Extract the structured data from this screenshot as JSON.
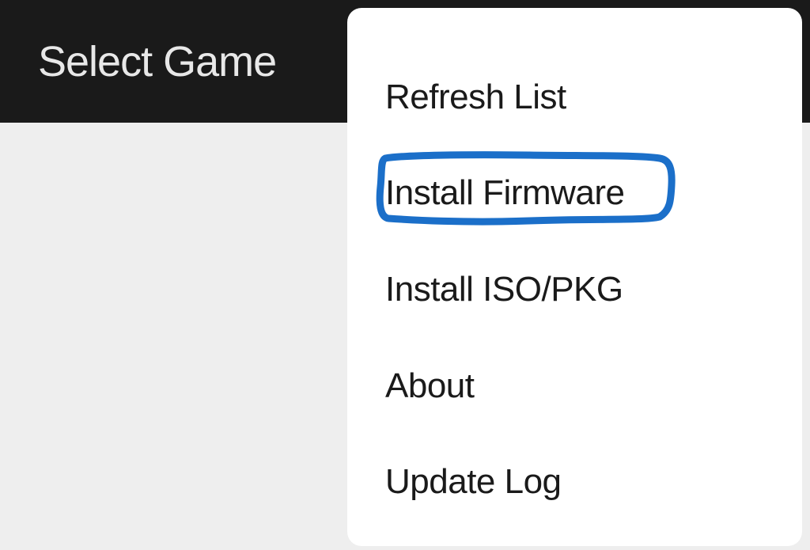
{
  "header": {
    "title": "Select Game"
  },
  "menu": {
    "items": [
      {
        "label": "Refresh List"
      },
      {
        "label": "Install Firmware"
      },
      {
        "label": "Install ISO/PKG"
      },
      {
        "label": "About"
      },
      {
        "label": "Update Log"
      }
    ]
  },
  "annotation": {
    "color": "#1b6fc9"
  }
}
